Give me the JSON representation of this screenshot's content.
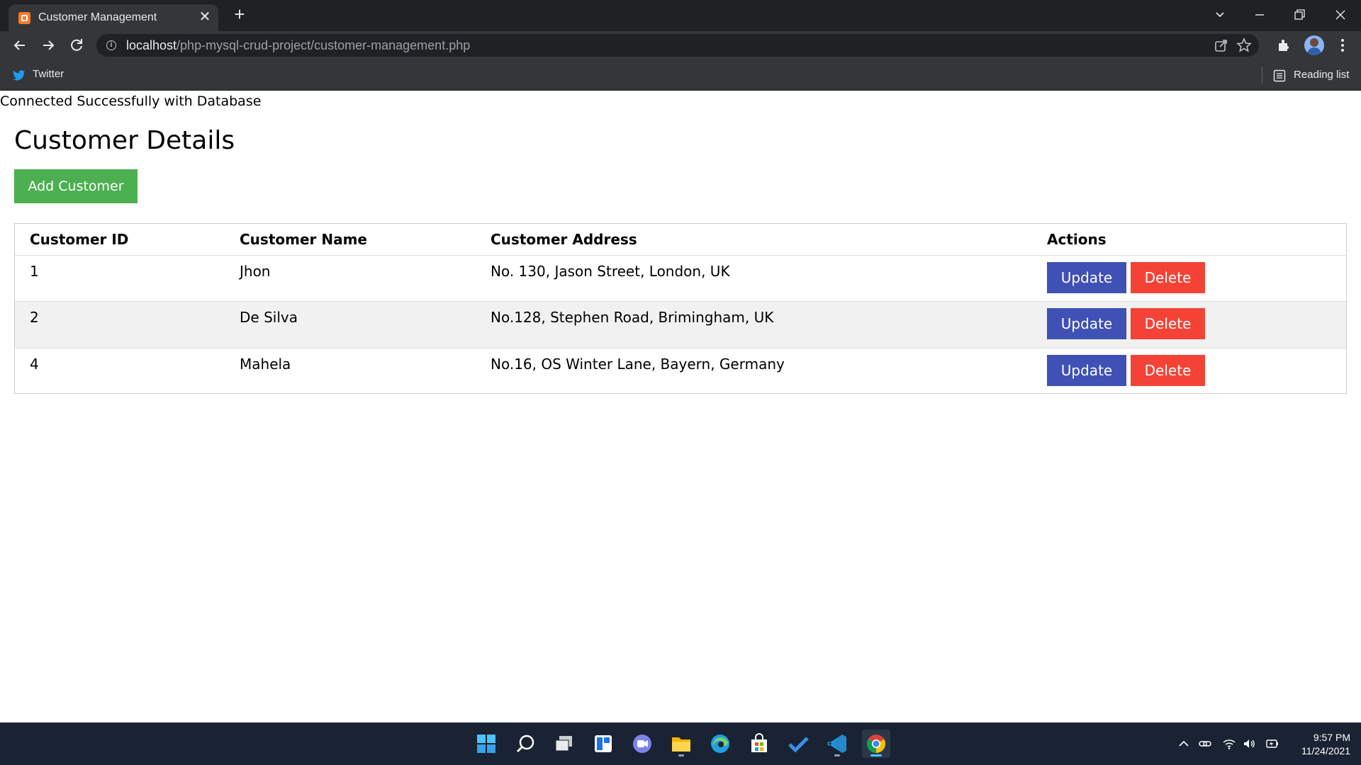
{
  "browser": {
    "tab": {
      "title": "Customer Management",
      "close_glyph": "✕",
      "favicon": "xampp-icon"
    },
    "new_tab_glyph": "+",
    "url": {
      "host": "localhost",
      "path": "/php-mysql-crud-project/customer-management.php"
    },
    "bookmarks": [
      {
        "label": "Twitter",
        "icon": "twitter-icon"
      }
    ],
    "reading_list_label": "Reading list"
  },
  "page": {
    "connection_message": "Connected Successfully with Database",
    "title": "Customer Details",
    "add_button_label": "Add Customer",
    "table": {
      "headers": [
        "Customer ID",
        "Customer Name",
        "Customer Address",
        "Actions"
      ],
      "rows": [
        {
          "id": "1",
          "name": "Jhon",
          "address": "No. 130, Jason Street, London, UK"
        },
        {
          "id": "2",
          "name": "De Silva",
          "address": "No.128, Stephen Road, Brimingham, UK"
        },
        {
          "id": "4",
          "name": "Mahela",
          "address": "No.16, OS Winter Lane, Bayern, Germany"
        }
      ],
      "update_label": "Update",
      "delete_label": "Delete"
    },
    "colors": {
      "add": "#4caf50",
      "update": "#3f51b5",
      "delete": "#f44336",
      "alt_row": "#f1f1f1"
    }
  },
  "taskbar": {
    "apps": [
      "start-icon",
      "search-icon",
      "task-view-icon",
      "widgets-icon",
      "teams-chat-icon",
      "file-explorer-icon",
      "edge-icon",
      "store-icon",
      "todo-icon",
      "vscode-icon",
      "chrome-icon"
    ],
    "time": "9:57 PM",
    "date": "11/24/2021"
  }
}
